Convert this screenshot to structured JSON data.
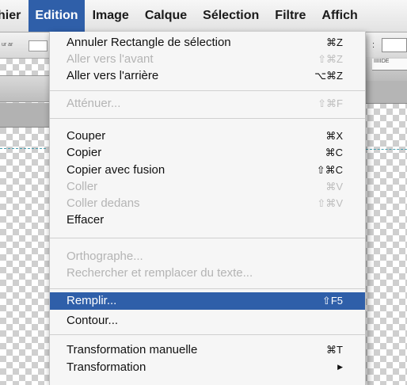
{
  "menubar": {
    "items": [
      {
        "label": "hier",
        "active": false
      },
      {
        "label": "Edition",
        "active": true
      },
      {
        "label": "Image",
        "active": false
      },
      {
        "label": "Calque",
        "active": false
      },
      {
        "label": "Sélection",
        "active": false
      },
      {
        "label": "Filtre",
        "active": false
      },
      {
        "label": "Affich",
        "active": false
      }
    ]
  },
  "background": {
    "toolbar_left_label": "ur ar",
    "ruler_label": "IIIIIDE",
    "colon": ":"
  },
  "menu": {
    "items": [
      {
        "label": "Annuler Rectangle de sélection",
        "shortcut": "⌘Z",
        "state": "enabled"
      },
      {
        "label": "Aller vers l'avant",
        "shortcut": "⇧⌘Z",
        "state": "disabled"
      },
      {
        "label": "Aller vers l'arrière",
        "shortcut": "⌥⌘Z",
        "state": "enabled"
      },
      {
        "label": "Atténuer...",
        "shortcut": "⇧⌘F",
        "state": "disabled"
      },
      {
        "label": "Couper",
        "shortcut": "⌘X",
        "state": "enabled"
      },
      {
        "label": "Copier",
        "shortcut": "⌘C",
        "state": "enabled"
      },
      {
        "label": "Copier avec fusion",
        "shortcut": "⇧⌘C",
        "state": "enabled"
      },
      {
        "label": "Coller",
        "shortcut": "⌘V",
        "state": "disabled"
      },
      {
        "label": "Coller dedans",
        "shortcut": "⇧⌘V",
        "state": "disabled"
      },
      {
        "label": "Effacer",
        "shortcut": "",
        "state": "enabled"
      },
      {
        "label": "Orthographe...",
        "shortcut": "",
        "state": "disabled"
      },
      {
        "label": "Rechercher et remplacer du texte...",
        "shortcut": "",
        "state": "disabled"
      },
      {
        "label": "Remplir...",
        "shortcut": "⇧F5",
        "state": "highlighted"
      },
      {
        "label": "Contour...",
        "shortcut": "",
        "state": "enabled"
      },
      {
        "label": "Transformation manuelle",
        "shortcut": "⌘T",
        "state": "enabled"
      },
      {
        "label": "Transformation",
        "shortcut": "▶",
        "state": "enabled"
      }
    ]
  }
}
